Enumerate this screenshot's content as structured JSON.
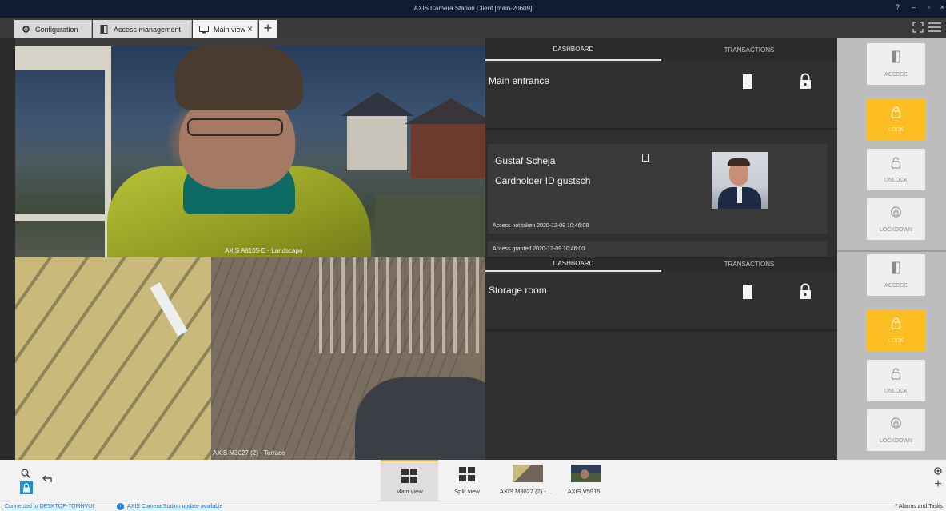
{
  "window": {
    "title": "AXIS Camera Station Client [main-20609]",
    "controls": [
      "?",
      "–",
      "▫",
      "×"
    ]
  },
  "tabs": [
    {
      "label": "Configuration",
      "icon": "gear-icon"
    },
    {
      "label": "Access management",
      "icon": "door-icon"
    },
    {
      "label": "Main view",
      "icon": "monitor-icon",
      "active": true
    }
  ],
  "cameras": [
    {
      "caption": "AXIS A8105-E - Landscape"
    },
    {
      "caption": "AXIS M3027 (2) - Terrace"
    }
  ],
  "doors": [
    {
      "tab_dashboard": "DASHBOARD",
      "tab_transactions": "TRANSACTIONS",
      "name": "Main entrance",
      "cardholder": {
        "name": "Gustaf Scheja",
        "id_text": "Cardholder ID gustsch"
      },
      "events": [
        "Access not taken  2020-12-09 10:46:08",
        "Access granted  2020-12-09 10:46:00"
      ],
      "actions": {
        "access": "ACCESS",
        "lock": "LOCK",
        "unlock": "UNLOCK",
        "lockdown": "LOCKDOWN"
      }
    },
    {
      "tab_dashboard": "DASHBOARD",
      "tab_transactions": "TRANSACTIONS",
      "name": "Storage room",
      "actions": {
        "access": "ACCESS",
        "lock": "LOCK",
        "unlock": "UNLOCK",
        "lockdown": "LOCKDOWN"
      }
    }
  ],
  "accent": "#fbbd21",
  "taskbar": {
    "views": [
      {
        "label": "Main view",
        "active": true
      },
      {
        "label": "Split view"
      },
      {
        "label": "AXIS M3027 (2) -..."
      },
      {
        "label": "AXIS V5915"
      }
    ]
  },
  "status": {
    "connection": "Connected to DESKTOP-7GMHVUI",
    "update": "AXIS Camera Station update available",
    "alarms": "Alarms and Tasks"
  }
}
